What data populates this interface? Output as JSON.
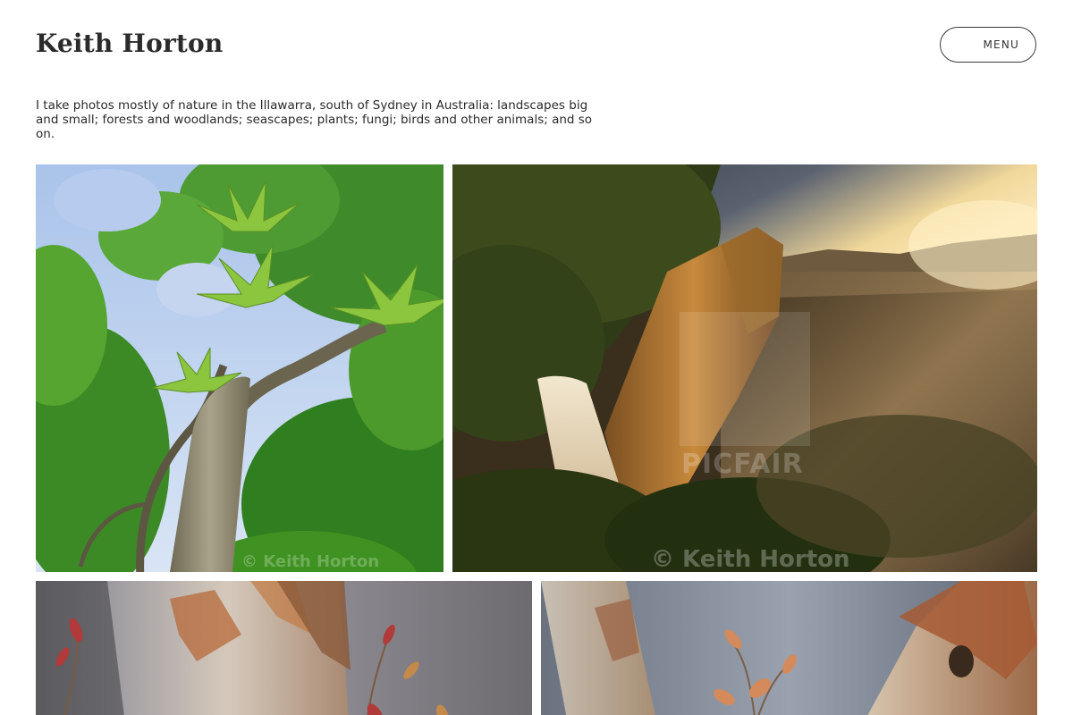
{
  "header": {
    "site_title": "Keith Horton",
    "menu_label": "MENU"
  },
  "intro": {
    "text": "I take photos mostly of nature in the Illawarra, south of Sydney in Australia: landscapes big and small; forests and woodlands; seascapes; plants; fungi; birds and other animals; and so on."
  },
  "gallery": {
    "photos": [
      {
        "subject": "Tall rainforest tree with bird's nest ferns against blue sky",
        "watermark": "© Keith Horton"
      },
      {
        "subject": "Waterfall cascading down a sandstone cliff into misty forested valley at sunset",
        "watermark": "© Keith Horton",
        "logo_watermark": "PICFAIR"
      },
      {
        "subject": "Eucalyptus trunk with peeling bark and red new growth",
        "watermark": ""
      },
      {
        "subject": "Two eucalyptus trunks with new shoots between them",
        "watermark": ""
      }
    ]
  },
  "colors": {
    "text": "#2a2a2a",
    "background": "#ffffff",
    "button_border": "#3a3a3a"
  }
}
